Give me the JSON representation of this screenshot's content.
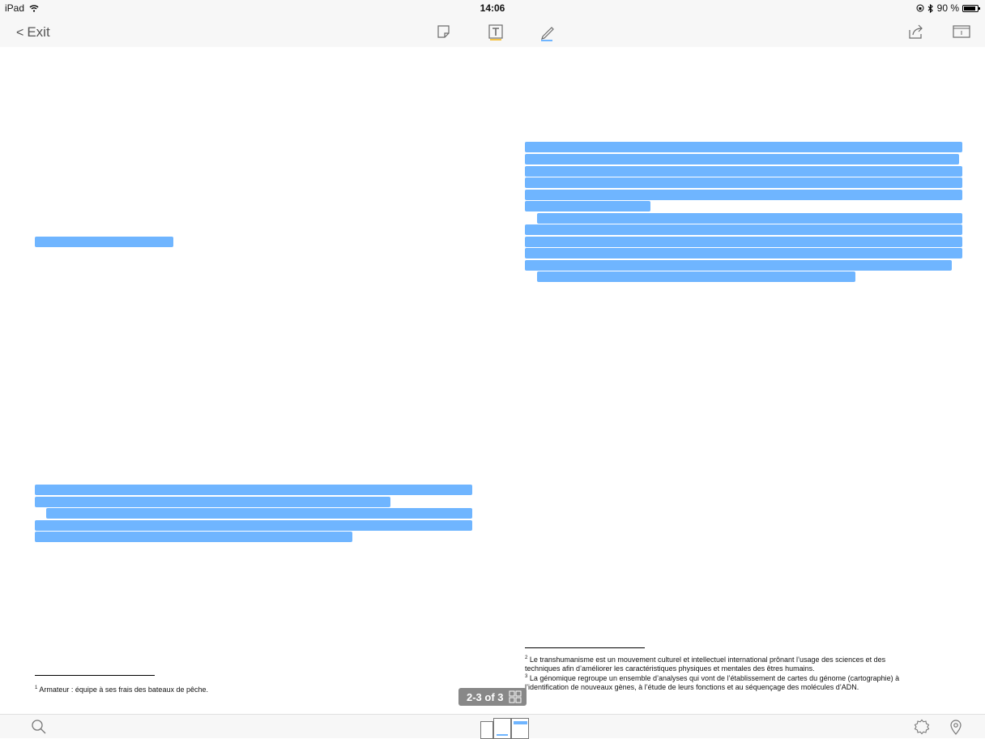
{
  "status": {
    "device": "iPad",
    "time": "14:06",
    "battery": "90 %",
    "battery_level": 0.9
  },
  "toolbar": {
    "exit_label": "Exit",
    "icons": [
      "note-icon",
      "text-tool-icon",
      "pen-icon",
      "share-icon",
      "reader-mode-icon"
    ]
  },
  "highlight_color": "#6fb5ff",
  "footnotes": {
    "left": [
      {
        "num": "1",
        "text": "Armateur : équipe à ses frais des bateaux de pêche."
      }
    ],
    "right": [
      {
        "num": "2",
        "line1": "Le transhumanisme est un mouvement culturel et intellectuel international prônant l’usage des sciences et des",
        "line2": "techniques afin d’améliorer les caractéristiques physiques et mentales des êtres humains."
      },
      {
        "num": "3",
        "line1": "La génomique regroupe un ensemble d’analyses qui vont de l’établissement de cartes du génome (cartographie) à",
        "line2": "l’identification de nouveaux gènes, à l’étude de leurs fonctions et au séquençage des molécules d’ADN."
      }
    ]
  },
  "page_indicator": "2-3 of 3",
  "bottombar": {
    "icons": [
      "search-icon",
      "settings-icon",
      "location-pin-icon"
    ]
  }
}
